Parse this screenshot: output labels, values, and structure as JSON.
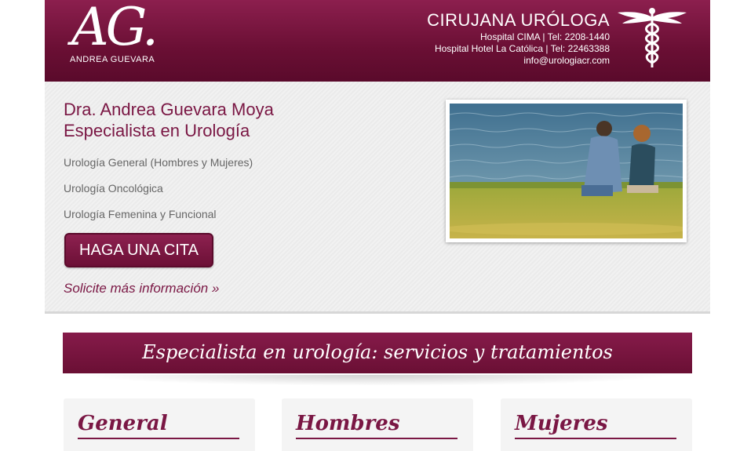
{
  "header": {
    "logo_monogram": "AG.",
    "logo_name": "ANDREA GUEVARA",
    "title": "CIRUJANA URÓLOGA",
    "line1": "Hospital CIMA | Tel: 2208-1440",
    "line2": "Hospital Hotel La Católica | Tel: 22463388",
    "email": "info@urologiacr.com",
    "emblem_icon": "caduceus-icon"
  },
  "hero": {
    "title_line1": "Dra. Andrea Guevara Moya",
    "title_line2": "Especialista en Urología",
    "services": [
      "Urología General (Hombres y Mujeres)",
      "Urología Oncológica",
      "Urología Femenina y Funcional"
    ],
    "cta_label": "HAGA UNA CITA",
    "more_link": "Solicite más información »"
  },
  "banner": {
    "title": "Especialista en urología: servicios y tratamientos"
  },
  "cards": [
    {
      "title": "General"
    },
    {
      "title": "Hombres"
    },
    {
      "title": "Mujeres"
    }
  ],
  "colors": {
    "brand": "#7a1744",
    "brand_dark": "#5a0a2b",
    "panel": "#ebebeb"
  }
}
